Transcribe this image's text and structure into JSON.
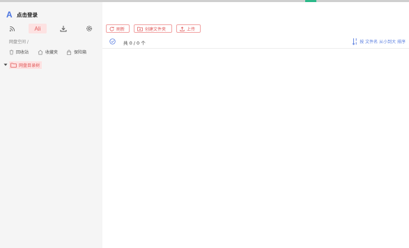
{
  "sidebar": {
    "login_text": "点击登录",
    "logo_letter": "A",
    "nav": {
      "ali_label": "Ali"
    },
    "breadcrumb": "网盘空间 /",
    "quick_access": {
      "recycle": "回收站",
      "favorites": "收藏夹",
      "safebox": "保险箱"
    },
    "tree_root": "网盘目录树"
  },
  "toolbar": {
    "refresh": "刷新",
    "new_folder": "创建文件夹",
    "upload": "上传"
  },
  "list": {
    "count_text": "共 0 / 0 个",
    "sort_text": "按 文件名 从小到大 排序"
  },
  "colors": {
    "accent": "#e05a5a",
    "accent_bg": "#fde2e2",
    "link": "#5b7fe0"
  }
}
